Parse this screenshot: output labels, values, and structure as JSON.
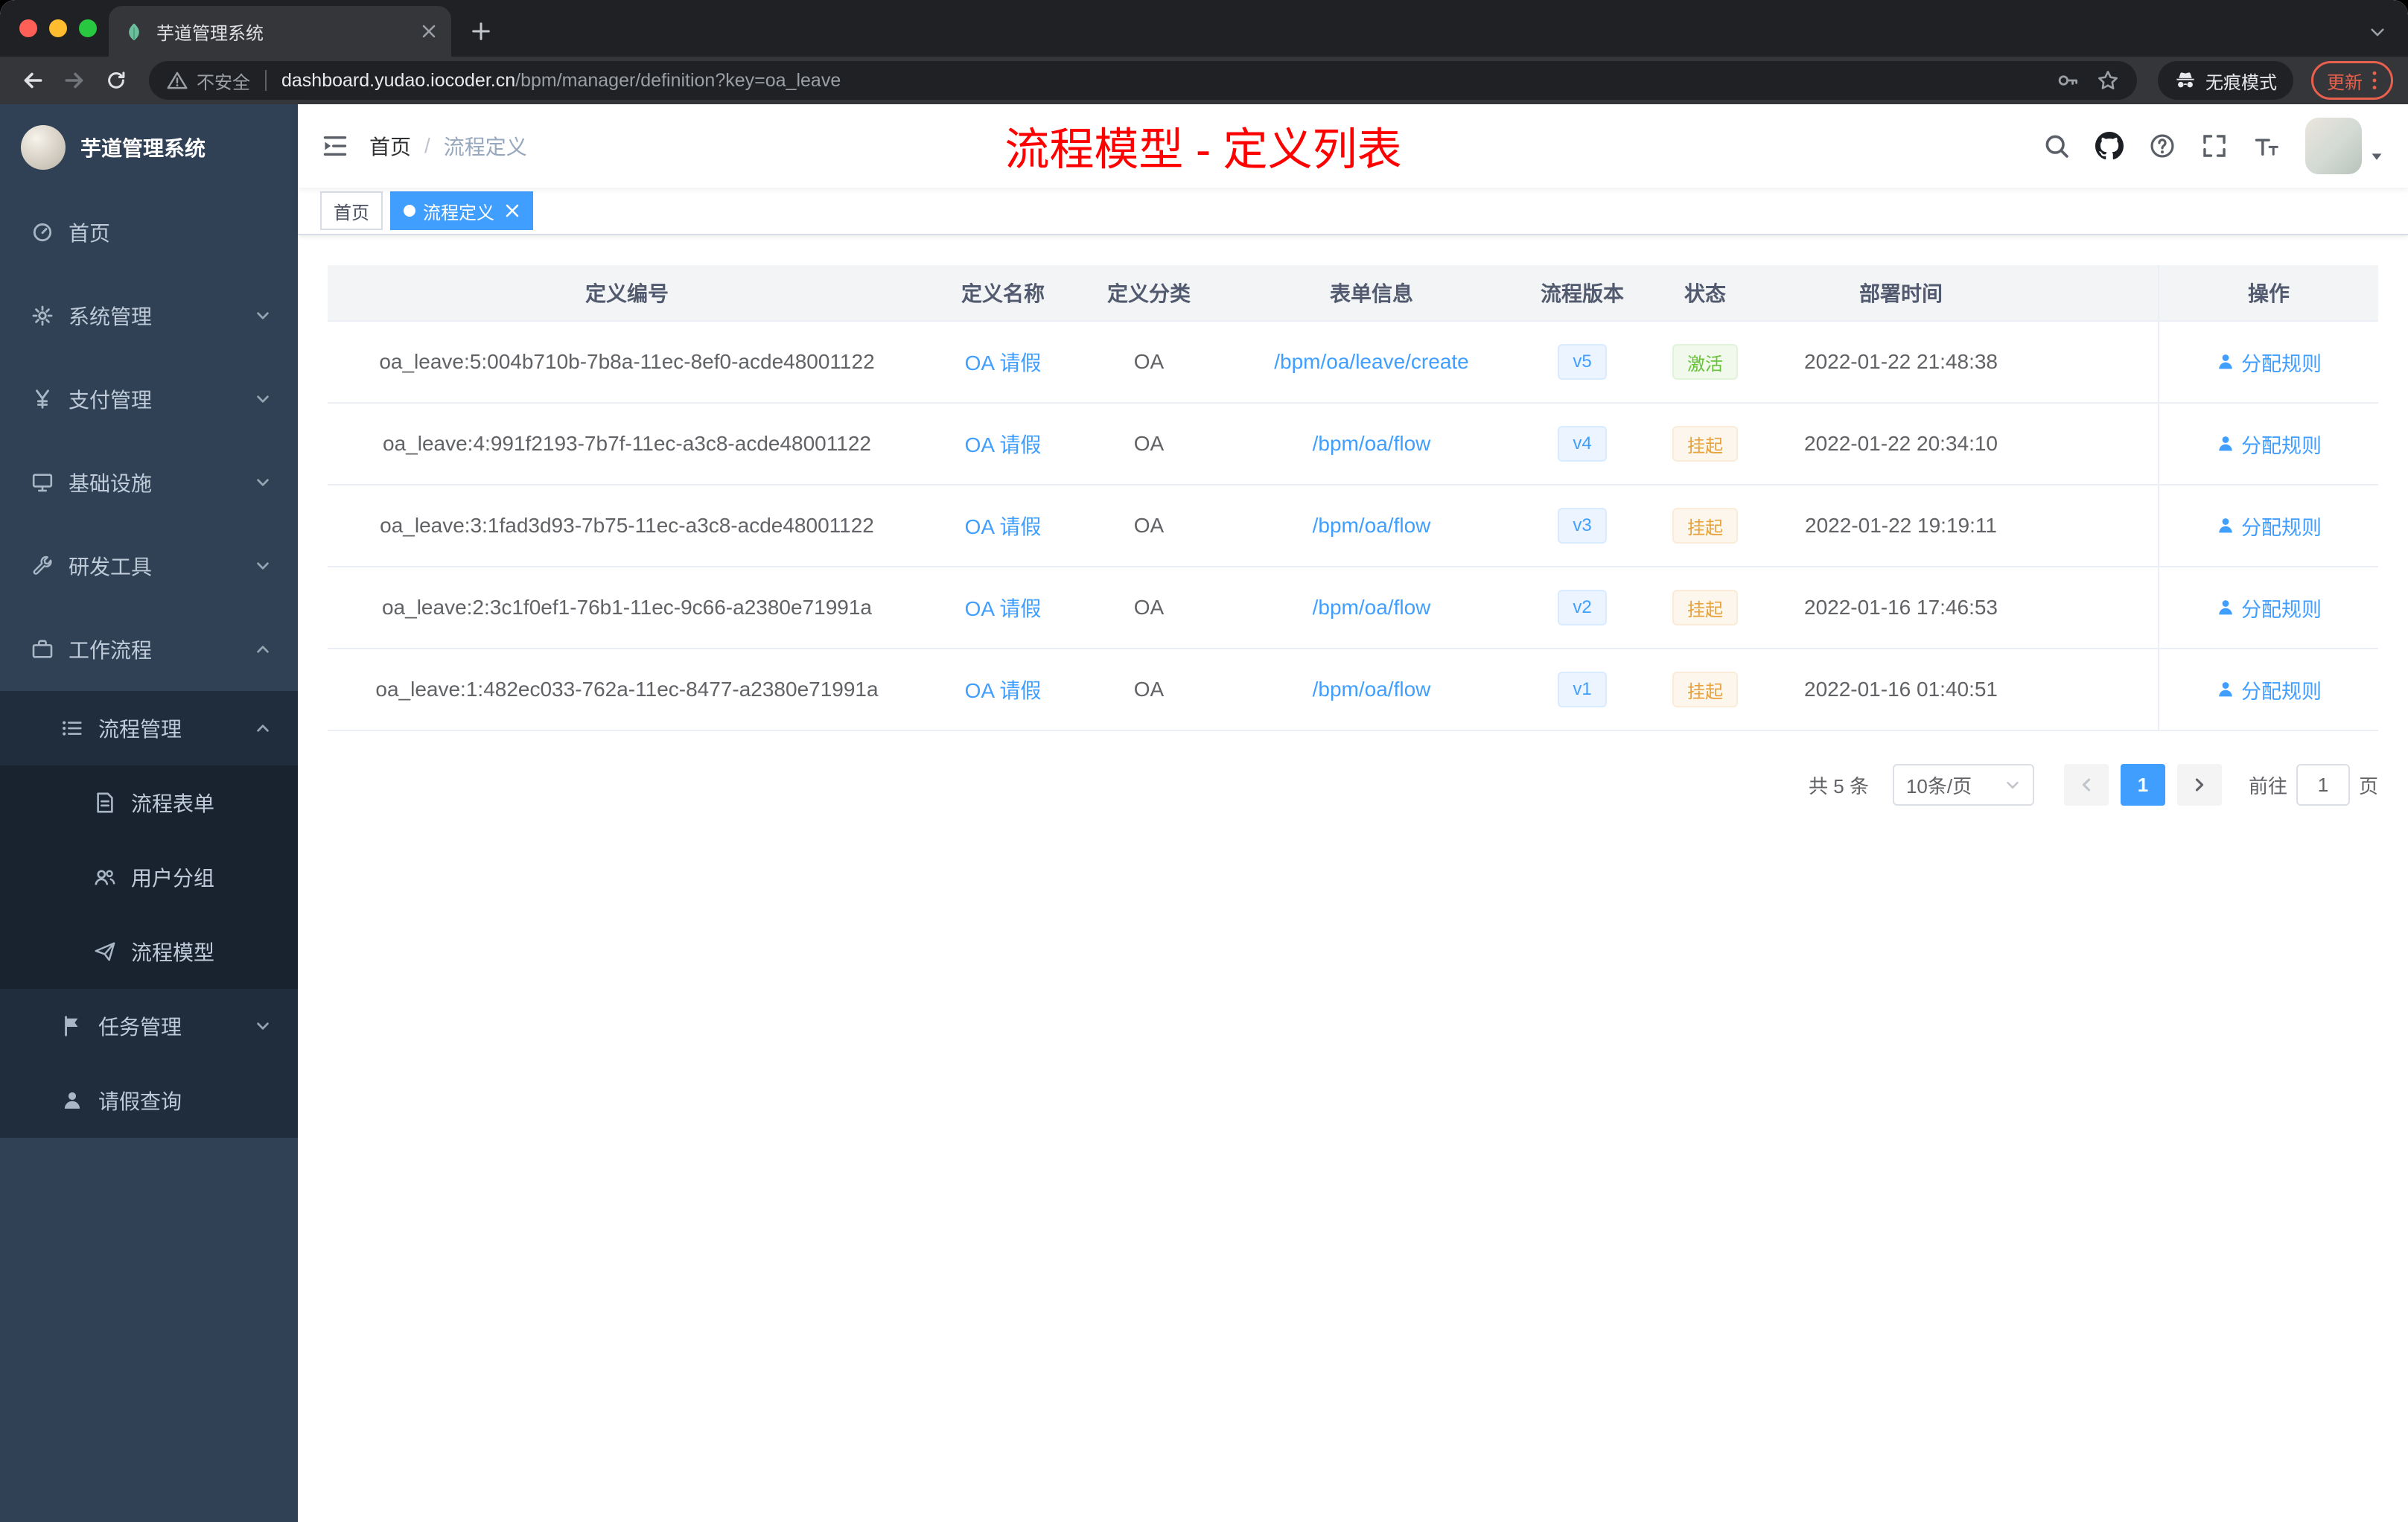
{
  "browser": {
    "tab_title": "芋道管理系统",
    "security_label": "不安全",
    "url_domain": "dashboard.yudao.iocoder.cn",
    "url_path": "/bpm/manager/definition?key=oa_leave",
    "incognito_label": "无痕模式",
    "update_label": "更新"
  },
  "sidebar": {
    "logo_title": "芋道管理系统",
    "menu": [
      {
        "key": "home",
        "label": "首页",
        "icon": "dashboard-icon",
        "level": 0
      },
      {
        "key": "system",
        "label": "系统管理",
        "icon": "gear-icon",
        "level": 0,
        "chevron": "down"
      },
      {
        "key": "payment",
        "label": "支付管理",
        "icon": "yen-icon",
        "level": 0,
        "chevron": "down"
      },
      {
        "key": "infrastructure",
        "label": "基础设施",
        "icon": "infrastructure-icon",
        "level": 0,
        "chevron": "down"
      },
      {
        "key": "devtools",
        "label": "研发工具",
        "icon": "tools-icon",
        "level": 0,
        "chevron": "down"
      },
      {
        "key": "workflow",
        "label": "工作流程",
        "icon": "workflow-icon",
        "level": 0,
        "chevron": "up"
      },
      {
        "key": "process-management",
        "label": "流程管理",
        "icon": "process-list-icon",
        "level": 1,
        "chevron": "up"
      },
      {
        "key": "process-form",
        "label": "流程表单",
        "icon": "form-icon",
        "level": 2
      },
      {
        "key": "user-group",
        "label": "用户分组",
        "icon": "user-group-icon",
        "level": 2
      },
      {
        "key": "process-model",
        "label": "流程模型",
        "icon": "model-icon",
        "level": 2
      },
      {
        "key": "task-management",
        "label": "任务管理",
        "icon": "task-icon",
        "level": 1,
        "chevron": "down"
      },
      {
        "key": "leave-query",
        "label": "请假查询",
        "icon": "person-icon",
        "level": 1
      }
    ]
  },
  "header": {
    "breadcrumb": [
      "首页",
      "流程定义"
    ],
    "breadcrumb_separator": "/",
    "annotation": "流程模型 - 定义列表"
  },
  "tags": [
    {
      "key": "home",
      "label": "首页",
      "active": false,
      "closable": false
    },
    {
      "key": "process-definition",
      "label": "流程定义",
      "active": true,
      "closable": true
    }
  ],
  "table": {
    "columns": [
      {
        "key": "definition-id",
        "label": "定义编号"
      },
      {
        "key": "definition-name",
        "label": "定义名称"
      },
      {
        "key": "definition-category",
        "label": "定义分类"
      },
      {
        "key": "form-info",
        "label": "表单信息"
      },
      {
        "key": "process-version",
        "label": "流程版本"
      },
      {
        "key": "status",
        "label": "状态"
      },
      {
        "key": "deploy-time",
        "label": "部署时间"
      },
      {
        "key": "actions",
        "label": "操作"
      }
    ],
    "rows": [
      {
        "id": "oa_leave:5:004b710b-7b8a-11ec-8ef0-acde48001122",
        "name": "OA 请假",
        "category": "OA",
        "form": "/bpm/oa/leave/create",
        "version": "v5",
        "status": "激活",
        "status_type": "success",
        "time": "2022-01-22 21:48:38",
        "action": "分配规则"
      },
      {
        "id": "oa_leave:4:991f2193-7b7f-11ec-a3c8-acde48001122",
        "name": "OA 请假",
        "category": "OA",
        "form": "/bpm/oa/flow",
        "version": "v4",
        "status": "挂起",
        "status_type": "warning",
        "time": "2022-01-22 20:34:10",
        "action": "分配规则"
      },
      {
        "id": "oa_leave:3:1fad3d93-7b75-11ec-a3c8-acde48001122",
        "name": "OA 请假",
        "category": "OA",
        "form": "/bpm/oa/flow",
        "version": "v3",
        "status": "挂起",
        "status_type": "warning",
        "time": "2022-01-22 19:19:11",
        "action": "分配规则"
      },
      {
        "id": "oa_leave:2:3c1f0ef1-76b1-11ec-9c66-a2380e71991a",
        "name": "OA 请假",
        "category": "OA",
        "form": "/bpm/oa/flow",
        "version": "v2",
        "status": "挂起",
        "status_type": "warning",
        "time": "2022-01-16 17:46:53",
        "action": "分配规则"
      },
      {
        "id": "oa_leave:1:482ec033-762a-11ec-8477-a2380e71991a",
        "name": "OA 请假",
        "category": "OA",
        "form": "/bpm/oa/flow",
        "version": "v1",
        "status": "挂起",
        "status_type": "warning",
        "time": "2022-01-16 01:40:51",
        "action": "分配规则"
      }
    ]
  },
  "pagination": {
    "total": "共 5 条",
    "page_size": "10条/页",
    "page": "1",
    "goto_label": "前往",
    "goto_value": "1",
    "goto_unit": "页"
  },
  "colors": {
    "accent": "#409eff",
    "success": "#67c23a",
    "warning": "#e6a23c",
    "annotation_red": "#ff0000",
    "sidebar_bg": "#304156",
    "sidebar_sub_bg": "#1f2d3d"
  }
}
